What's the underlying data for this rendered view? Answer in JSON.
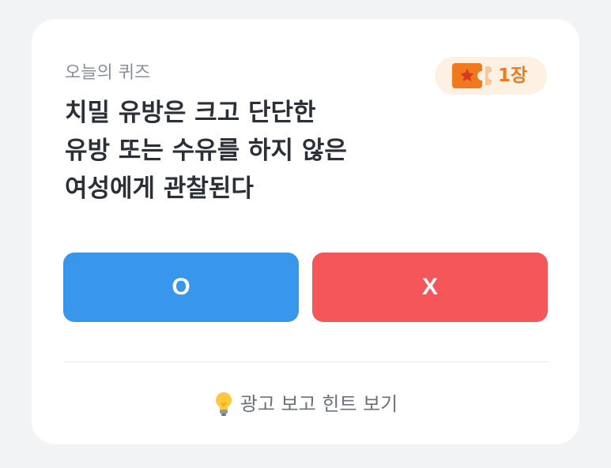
{
  "quiz": {
    "label": "오늘의 퀴즈",
    "ticket_icon": "ticket-star-icon",
    "ticket_count": "1장",
    "question": "치밀 유방은 크고 단단한\n유방 또는 수유를 하지 않은\n여성에게 관찰된다",
    "answer_o": "O",
    "answer_x": "X",
    "hint_icon": "lightbulb-icon",
    "hint_label": "광고 보고 힌트 보기"
  },
  "colors": {
    "o_button": "#3897ec",
    "x_button": "#f5565a",
    "ticket_accent": "#f0791e",
    "ticket_badge_bg": "#fdf1e3"
  }
}
